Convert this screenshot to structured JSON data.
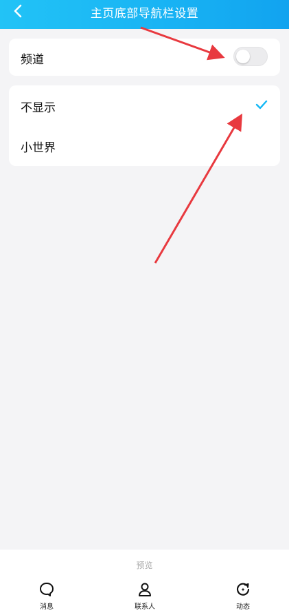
{
  "header": {
    "title": "主页底部导航栏设置",
    "back_icon": "chevron-left-icon"
  },
  "channel_setting": {
    "label": "频道",
    "toggle_on": false
  },
  "options": {
    "items": [
      {
        "label": "不显示",
        "selected": true
      },
      {
        "label": "小世界",
        "selected": false
      }
    ],
    "check_icon": "checkmark-icon"
  },
  "preview": {
    "label": "预览",
    "nav": [
      {
        "label": "消息",
        "icon": "message-bubble-icon"
      },
      {
        "label": "联系人",
        "icon": "person-icon"
      },
      {
        "label": "动态",
        "icon": "refresh-star-icon"
      }
    ]
  },
  "colors": {
    "header_start": "#22c3f6",
    "header_end": "#11a3ef",
    "accent": "#12b7f5",
    "annotation_arrow": "#e8393f",
    "background": "#f4f4f6"
  }
}
